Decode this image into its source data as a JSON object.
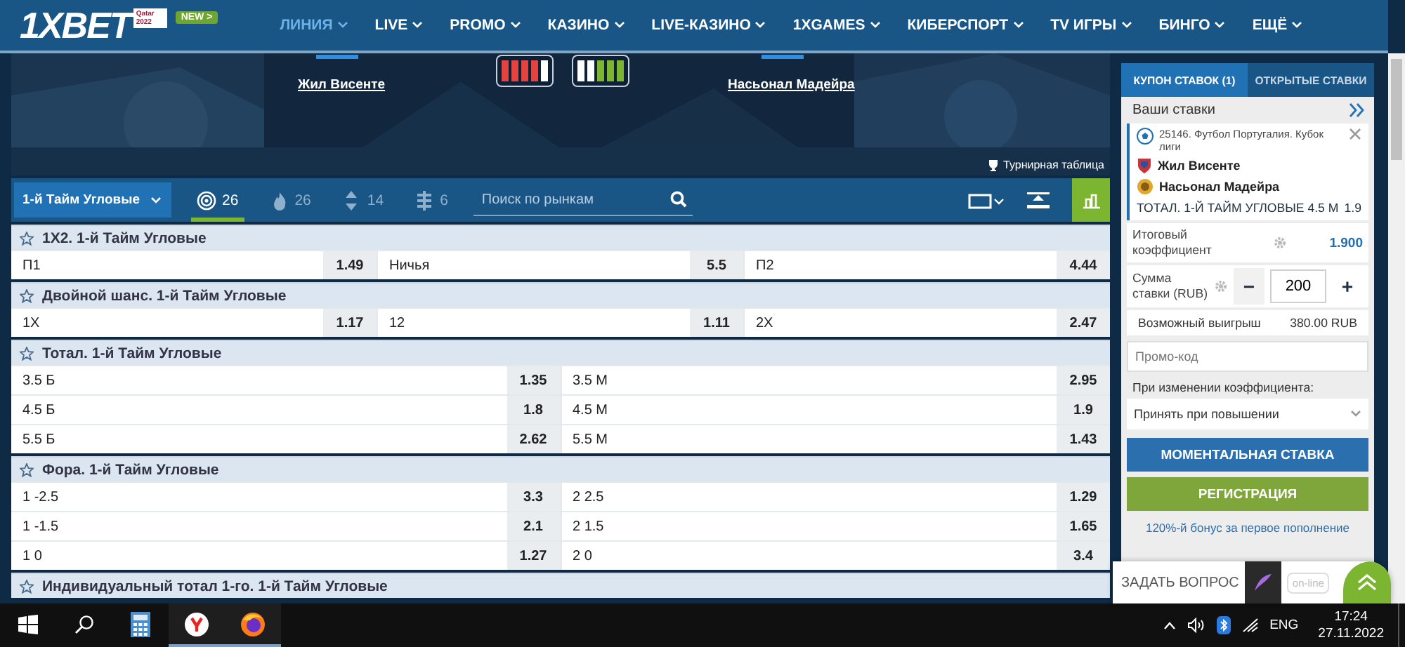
{
  "nav": {
    "logo": "1XBET",
    "promo_badge": "Qatar 2022",
    "new_badge": "NEW >",
    "items": [
      {
        "label": "ЛИНИЯ",
        "selected": true
      },
      {
        "label": "LIVE",
        "selected": false
      },
      {
        "label": "PROMO",
        "selected": false
      },
      {
        "label": "КАЗИНО",
        "selected": false
      },
      {
        "label": "LIVE-КАЗИНО",
        "selected": false
      },
      {
        "label": "1XGAMES",
        "selected": false
      },
      {
        "label": "КИБЕРСПОРТ",
        "selected": false
      },
      {
        "label": "TV ИГРЫ",
        "selected": false
      },
      {
        "label": "БИНГО",
        "selected": false
      },
      {
        "label": "ЕЩЁ",
        "selected": false
      }
    ]
  },
  "match": {
    "home": "Жил Висенте",
    "away": "Насьонал Мадейра",
    "standings_link": "Турнирная таблица",
    "home_form": [
      {
        "color": "#e5433f"
      },
      {
        "color": "#e5433f"
      },
      {
        "color": "#e5433f"
      },
      {
        "color": "#e5433f"
      },
      {
        "color": "#ffffff"
      }
    ],
    "away_form": [
      {
        "color": "#ffffff"
      },
      {
        "color": "#ffffff"
      },
      {
        "color": "#7cb530"
      },
      {
        "color": "#7cb530"
      },
      {
        "color": "#7cb530"
      }
    ]
  },
  "toolbar": {
    "period": "1-й Тайм Угловые",
    "filters": [
      {
        "kind": "target",
        "count": "26",
        "selected": true
      },
      {
        "kind": "fire",
        "count": "26",
        "selected": false
      },
      {
        "kind": "updown",
        "count": "14",
        "selected": false
      },
      {
        "kind": "bars",
        "count": "6",
        "selected": false
      }
    ],
    "search": {
      "placeholder": "Поиск по рынкам"
    }
  },
  "markets": [
    {
      "title": "1X2. 1-й Тайм Угловые",
      "rows": [
        [
          {
            "label": "П1",
            "odds": "1.49"
          },
          {
            "label": "Ничья",
            "odds": "5.5"
          },
          {
            "label": "П2",
            "odds": "4.44"
          }
        ]
      ]
    },
    {
      "title": "Двойной шанс. 1-й Тайм Угловые",
      "rows": [
        [
          {
            "label": "1X",
            "odds": "1.17"
          },
          {
            "label": "12",
            "odds": "1.11"
          },
          {
            "label": "2X",
            "odds": "2.47"
          }
        ]
      ]
    },
    {
      "title": "Тотал. 1-й Тайм Угловые",
      "rows": [
        [
          {
            "label": "3.5 Б",
            "odds": "1.35"
          },
          {
            "label": "3.5 М",
            "odds": "2.95"
          }
        ],
        [
          {
            "label": "4.5 Б",
            "odds": "1.8"
          },
          {
            "label": "4.5 М",
            "odds": "1.9"
          }
        ],
        [
          {
            "label": "5.5 Б",
            "odds": "2.62"
          },
          {
            "label": "5.5 М",
            "odds": "1.43"
          }
        ]
      ]
    },
    {
      "title": "Фора. 1-й Тайм Угловые",
      "rows": [
        [
          {
            "label": "1 -2.5",
            "odds": "3.3"
          },
          {
            "label": "2 2.5",
            "odds": "1.29"
          }
        ],
        [
          {
            "label": "1 -1.5",
            "odds": "2.1"
          },
          {
            "label": "2 1.5",
            "odds": "1.65"
          }
        ],
        [
          {
            "label": "1 0",
            "odds": "1.27"
          },
          {
            "label": "2 0",
            "odds": "3.4"
          }
        ]
      ]
    },
    {
      "title": "Индивидуальный тотал 1-го. 1-й Тайм Угловые"
    }
  ],
  "coupon": {
    "tabs": [
      {
        "label": "КУПОН СТАВОК (1)",
        "selected": true
      },
      {
        "label": "ОТКРЫТЫЕ СТАВКИ",
        "selected": false
      }
    ],
    "heading": "Ваши ставки",
    "bet": {
      "event": "25146. Футбол Португалия. Кубок лиги",
      "home": "Жил Висенте",
      "away": "Насьонал Мадейра",
      "market": "ТОТАЛ. 1-Й ТАЙМ УГЛОВЫЕ 4.5 М",
      "odds": "1.9"
    },
    "total_label": "Итоговый коэффициент",
    "total_value": "1.900",
    "stake_label": "Сумма ставки (RUB)",
    "stake_minus": "−",
    "stake_value": "200",
    "stake_plus": "+",
    "win_label": "Возможный выигрыш",
    "win_value": "380.00 RUB",
    "promo": {
      "placeholder": "Промо-код"
    },
    "change_label": "При изменении коэффициента:",
    "change_value": "Принять при повышении",
    "instant_button": "МОМЕНТАЛЬНАЯ СТАВКА",
    "register_button": "РЕГИСТРАЦИЯ",
    "bonus": "120%-й бонус за первое пополнение"
  },
  "chat": {
    "label": "ЗАДАТЬ ВОПРОС",
    "status": "on-line"
  },
  "taskbar": {
    "apps": [
      {
        "kind": "calculator",
        "running": false
      },
      {
        "kind": "yandex",
        "running": true
      },
      {
        "kind": "firefox",
        "running": true
      }
    ],
    "language": "ENG",
    "time": "17:24",
    "date": "27.11.2022"
  }
}
